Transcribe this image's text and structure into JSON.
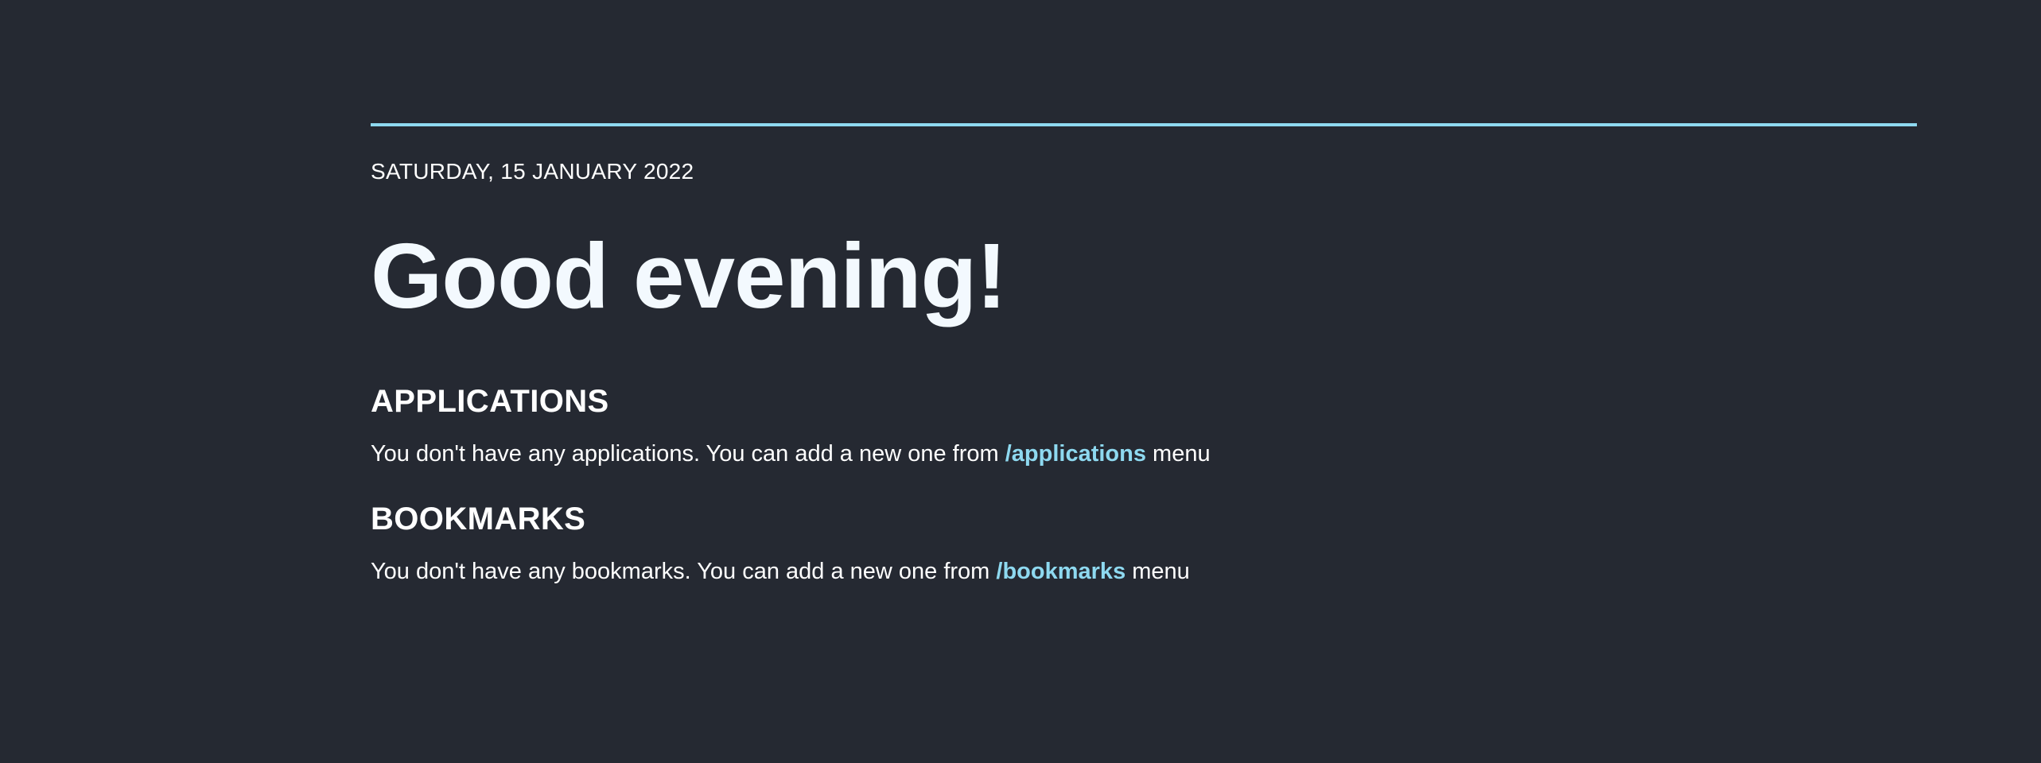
{
  "header": {
    "date": "SATURDAY, 15 JANUARY 2022",
    "greeting": "Good evening!"
  },
  "applications": {
    "title": "APPLICATIONS",
    "text_before": "You don't have any applications. You can add a new one from ",
    "link": "/applications",
    "text_after": " menu"
  },
  "bookmarks": {
    "title": "BOOKMARKS",
    "text_before": "You don't have any bookmarks. You can add a new one from ",
    "link": "/bookmarks",
    "text_after": " menu"
  },
  "colors": {
    "background": "#252932",
    "accent": "#8ed9f0",
    "text": "#ffffff"
  }
}
